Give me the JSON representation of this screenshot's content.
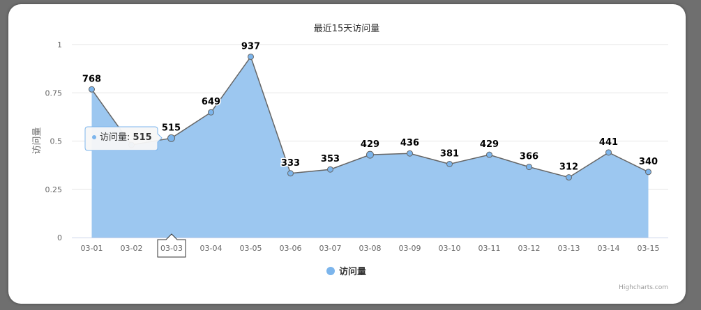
{
  "chart_data": {
    "type": "area",
    "title": "最近15天访问量",
    "ylabel": "访问量",
    "xlabel": "",
    "categories": [
      "03-01",
      "03-02",
      "03-03",
      "03-04",
      "03-05",
      "03-06",
      "03-07",
      "03-08",
      "03-09",
      "03-10",
      "03-11",
      "03-12",
      "03-13",
      "03-14",
      "03-15"
    ],
    "y_ticks": [
      "0",
      "0.25",
      "0.5",
      "0.75",
      "1"
    ],
    "ylim": [
      0,
      1
    ],
    "grid": true,
    "legend_position": "bottom-center",
    "series": [
      {
        "name": "访问量",
        "values": [
          0.768,
          0.48,
          0.515,
          0.649,
          0.937,
          0.333,
          0.353,
          0.429,
          0.436,
          0.381,
          0.429,
          0.366,
          0.312,
          0.441,
          0.34
        ],
        "data_labels": [
          "768",
          "",
          "515",
          "649",
          "937",
          "333",
          "353",
          "429",
          "436",
          "381",
          "429",
          "366",
          "312",
          "441",
          "340"
        ],
        "fill_color": "#9cc7f0",
        "line_color": "#666666",
        "marker_color": "#7cb5ec"
      }
    ],
    "tooltip": {
      "category_index": 2,
      "series_name": "访问量",
      "separator": ": ",
      "value_text": "515"
    },
    "credits": "Highcharts.com"
  }
}
